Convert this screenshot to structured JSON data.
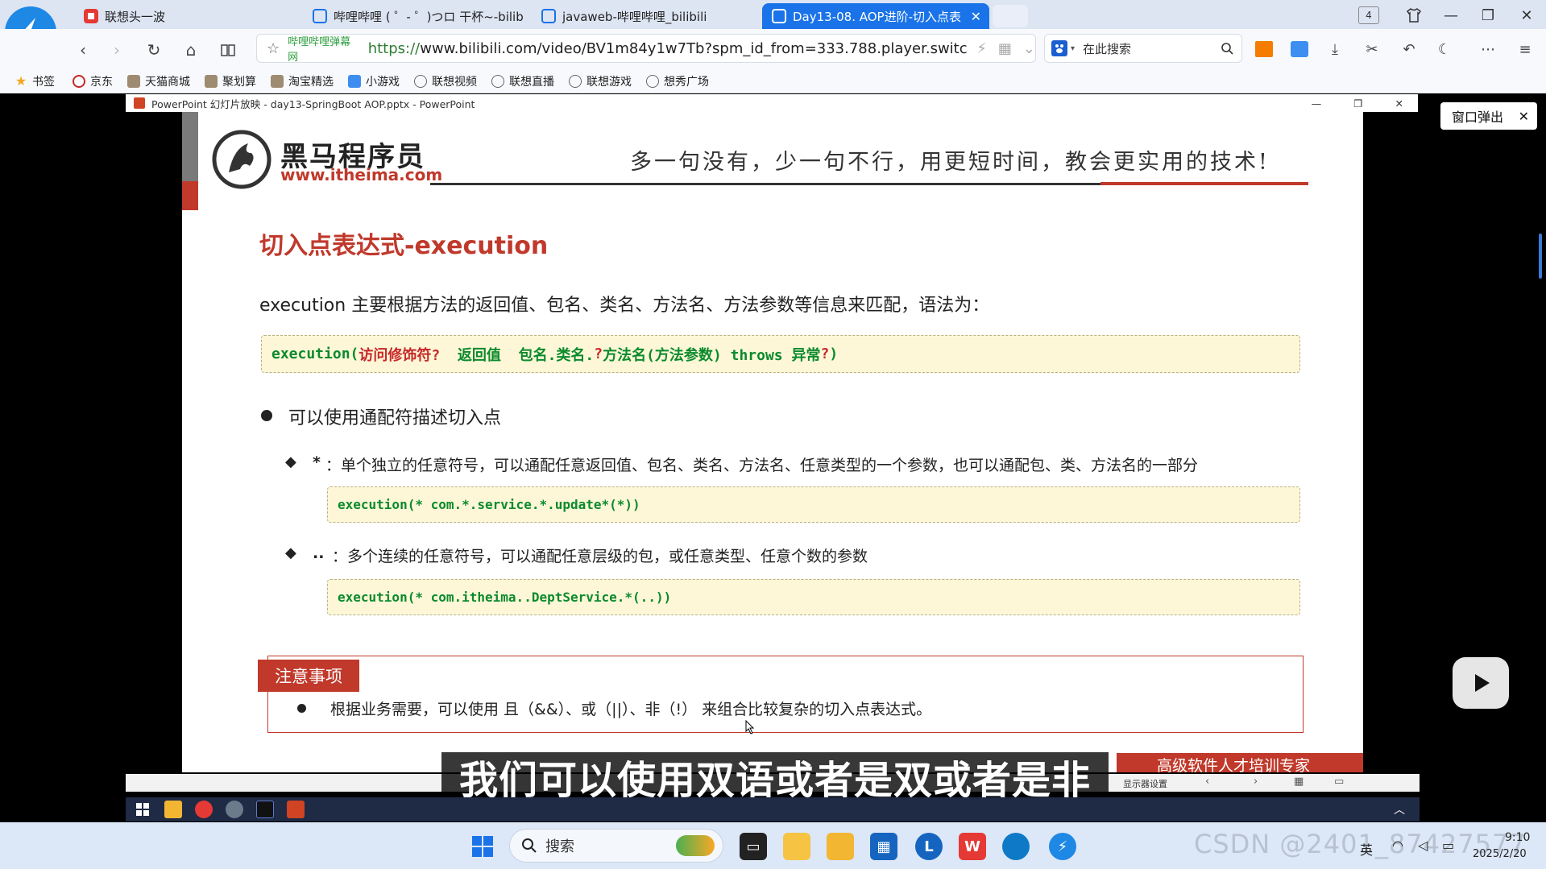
{
  "browser": {
    "tabs": [
      {
        "label": "联想头一波",
        "active": false
      },
      {
        "label": "哔哩哔哩 ( ゜- ゜)つロ 干杯~-bilib",
        "active": false
      },
      {
        "label": "javaweb-哔哩哔哩_bilibili",
        "active": false
      },
      {
        "label": "Day13-08. AOP进阶-切入点表",
        "active": true
      }
    ],
    "tab_count": "4",
    "site_badge": "哔哩哔哩弹幕网",
    "url": "https://www.bilibili.com/video/BV1m84y1w7Tb?spm_id_from=333.788.player.switc",
    "url_scheme": "https://",
    "url_rest": "www.bilibili.com/video/BV1m84y1w7Tb?spm_id_from=333.788.player.switc",
    "search_placeholder": "在此搜索",
    "bookmarks": [
      "书签",
      "京东",
      "天猫商城",
      "聚划算",
      "淘宝精选",
      "小游戏",
      "联想视频",
      "联想直播",
      "联想游戏",
      "想秀广场"
    ]
  },
  "ppt": {
    "window_title": "PowerPoint 幻灯片放映  -  day13-SpringBoot AOP.pptx - PowerPoint",
    "popout_label": "窗口弹出"
  },
  "slide": {
    "logo_name": "黑马程序员",
    "logo_url": "www.itheima.com",
    "slogan": "多一句没有，少一句不行，用更短时间，教会更实用的技术!",
    "title": "切入点表达式-execution",
    "intro": "execution 主要根据方法的返回值、包名、类名、方法名、方法参数等信息来匹配，语法为：",
    "syntax": {
      "p1": "execution(",
      "p2": "访问修饰符?",
      "p3": "  返回值  包名.类名.",
      "p4": "?",
      "p5": "方法名(方法参数) throws 异常",
      "p6": "?",
      "p7": ")"
    },
    "bullet": "可以使用通配符描述切入点",
    "star_symbol": "*",
    "star_desc": "：单个独立的任意符号，可以通配任意返回值、包名、类名、方法名、任意类型的一个参数，也可以通配包、类、方法名的一部分",
    "star_code": "execution(* com.*.service.*.update*(*))",
    "dots_symbol": "..",
    "dots_desc": "：多个连续的任意符号，可以通配任意层级的包，或任意类型、任意个数的参数",
    "dots_code": "execution(* com.itheima..DeptService.*(..))",
    "note_label": "注意事项",
    "note_text": "根据业务需要，可以使用 且（&&）、或（||）、非（!） 来组合比较复杂的切入点表达式。",
    "banner_text": "高级软件人才培训专家"
  },
  "video": {
    "subtitle": "我们可以使用双语或者是双或者是非",
    "controls_label": "显示器设置"
  },
  "taskbar": {
    "search_label": "搜索",
    "tray_lang": "英",
    "time": "9:10",
    "date": "2025/2/20",
    "watermark": "CSDN @2401_87427577"
  },
  "colors": {
    "accent_blue": "#1a73e8",
    "slide_red": "#c0392b",
    "code_green": "#0b8a2c",
    "code_bg": "#fdf7d8"
  }
}
